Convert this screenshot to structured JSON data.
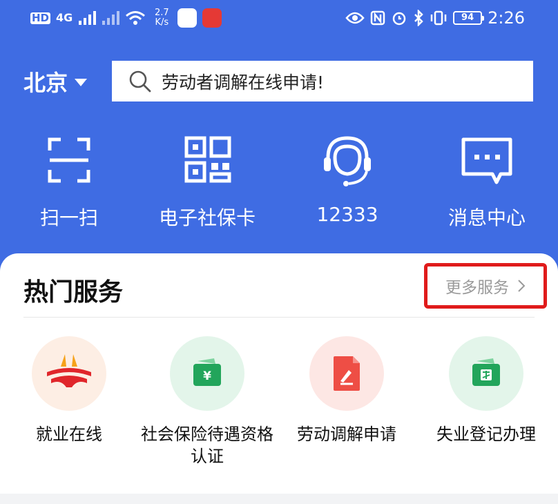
{
  "status_bar": {
    "hd": "HD",
    "network": "4G",
    "speed_value": "2.7",
    "speed_unit": "K/s",
    "battery": "94",
    "time": "2:26"
  },
  "header": {
    "city": "北京",
    "search_text": "劳动者调解在线申请!"
  },
  "quick_actions": [
    {
      "label": "扫一扫",
      "icon": "scan-icon"
    },
    {
      "label": "电子社保卡",
      "icon": "qr-code-icon"
    },
    {
      "label": "12333",
      "icon": "customer-service-headset-icon"
    },
    {
      "label": "消息中心",
      "icon": "message-icon"
    }
  ],
  "hot_services": {
    "title": "热门服务",
    "more_label": "更多服务",
    "items": [
      {
        "label": "就业在线",
        "icon": "employment-logo-icon",
        "circle_color": "#fdeee4"
      },
      {
        "label": "社会保险待遇资格认证",
        "icon": "yuan-wallet-icon",
        "circle_color": "#e3f5ea"
      },
      {
        "label": "劳动调解申请",
        "icon": "pen-document-icon",
        "circle_color": "#fde7e4"
      },
      {
        "label": "失业登记办理",
        "icon": "unemployment-wallet-icon",
        "circle_color": "#e3f5ea"
      }
    ]
  },
  "colors": {
    "primary_blue": "#3f6ce3",
    "highlight_red": "#e01b1b"
  }
}
